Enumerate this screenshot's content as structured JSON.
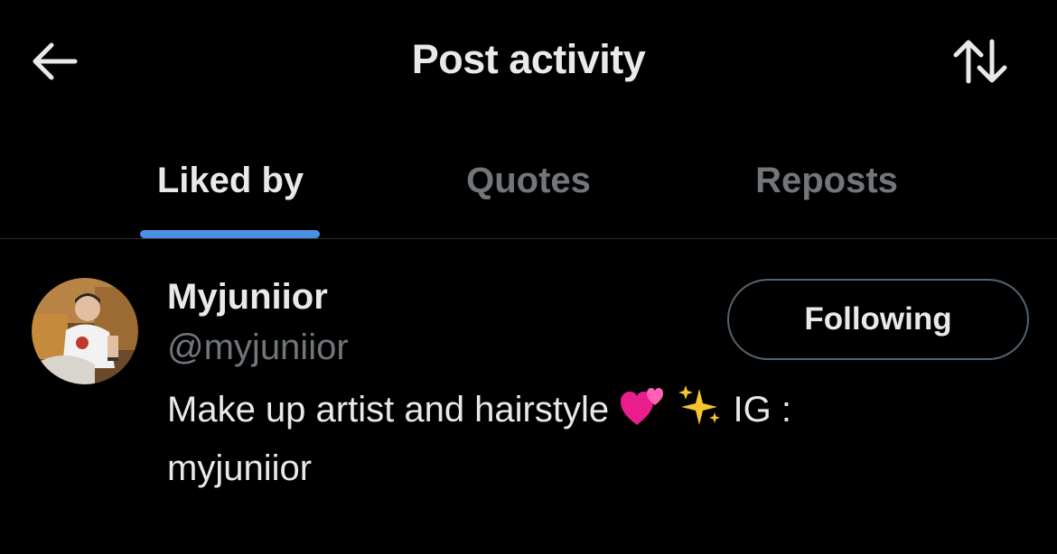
{
  "header": {
    "title": "Post activity",
    "back_icon": "arrow-left-icon",
    "sort_icon": "sort-arrows-icon"
  },
  "tabs": [
    {
      "label": "Liked by",
      "active": true
    },
    {
      "label": "Quotes",
      "active": false
    },
    {
      "label": "Reposts",
      "active": false
    }
  ],
  "user": {
    "display_name": "Myjuniior",
    "handle": "@myjuniior",
    "bio_before": "Make up artist and hairstyle",
    "bio_after": "IG :",
    "bio_line2": "myjuniior",
    "bio_emojis": [
      "two-hearts-icon",
      "sparkles-icon"
    ],
    "follow_label": "Following"
  },
  "colors": {
    "background": "#000000",
    "text_primary": "#e7e9ea",
    "text_secondary": "#71767b",
    "accent": "#4a90e2",
    "border": "#536471"
  }
}
